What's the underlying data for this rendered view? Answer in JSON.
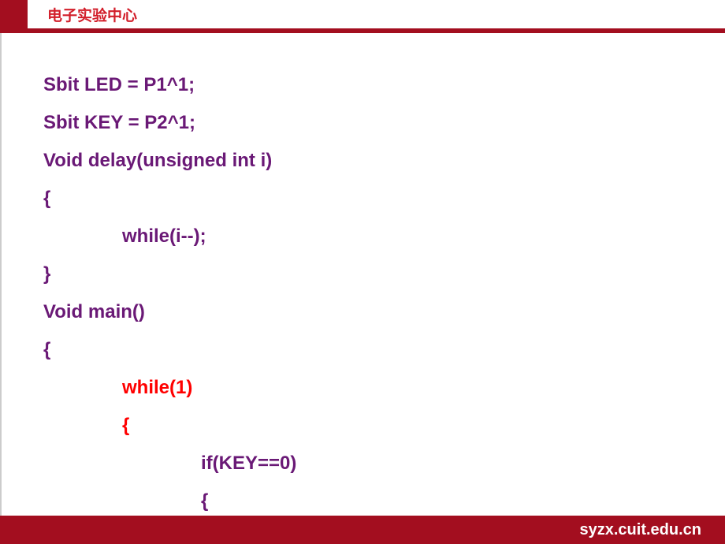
{
  "header": {
    "title": "电子实验中心"
  },
  "code": {
    "lines": [
      {
        "text": "Sbit LED = P1^1;",
        "indent": 0,
        "color": "purple"
      },
      {
        "text": "Sbit KEY = P2^1;",
        "indent": 0,
        "color": "purple"
      },
      {
        "text": "Void delay(unsigned int i)",
        "indent": 0,
        "color": "purple"
      },
      {
        "text": "{",
        "indent": 0,
        "color": "purple"
      },
      {
        "text": "while(i--);",
        "indent": 1,
        "color": "purple"
      },
      {
        "text": "}",
        "indent": 0,
        "color": "purple"
      },
      {
        "text": "Void main()",
        "indent": 0,
        "color": "purple"
      },
      {
        "text": "{",
        "indent": 0,
        "color": "purple"
      },
      {
        "text": "while(1)",
        "indent": 1,
        "color": "red"
      },
      {
        "text": "{",
        "indent": 1,
        "color": "red"
      },
      {
        "text": "if(KEY==0)",
        "indent": 2,
        "color": "purple"
      },
      {
        "text": "{",
        "indent": 2,
        "color": "purple"
      }
    ]
  },
  "footer": {
    "url": "syzx.cuit.edu.cn"
  }
}
